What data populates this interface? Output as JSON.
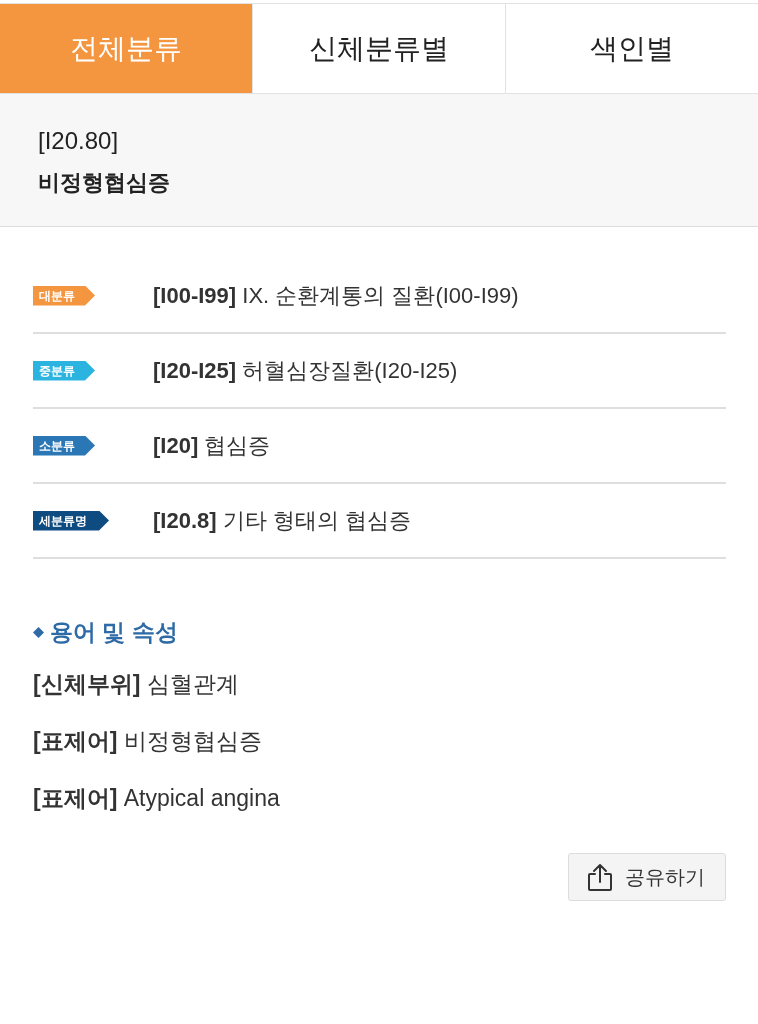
{
  "tabs": [
    {
      "label": "전체분류",
      "selected": true
    },
    {
      "label": "신체분류별",
      "selected": false
    },
    {
      "label": "색인별",
      "selected": false
    }
  ],
  "code_header": {
    "code": "[I20.80]",
    "name": "비정형협심증"
  },
  "hierarchy": [
    {
      "badge": "대분류",
      "color": "#f4963f",
      "text": "**[I00-I99]** IX. 순환계통의 질환(I00-I99)"
    },
    {
      "badge": "중분류",
      "color": "#2cb4e0",
      "text": "**[I20-I25]** 허혈심장질환(I20-I25)"
    },
    {
      "badge": "소분류",
      "color": "#2b77b5",
      "text": "**[I20]** 협심증"
    },
    {
      "badge": "세분류명",
      "color": "#0e4b80",
      "text": "**[I20.8]** 기타 형태의 협심증"
    }
  ],
  "terms_section": {
    "heading": "용어 및 속성",
    "items": [
      "**[신체부위]** 심혈관계",
      "**[표제어]** 비정형협심증",
      "**[표제어]** Atypical angina"
    ]
  },
  "share_button": {
    "label": "공유하기"
  }
}
